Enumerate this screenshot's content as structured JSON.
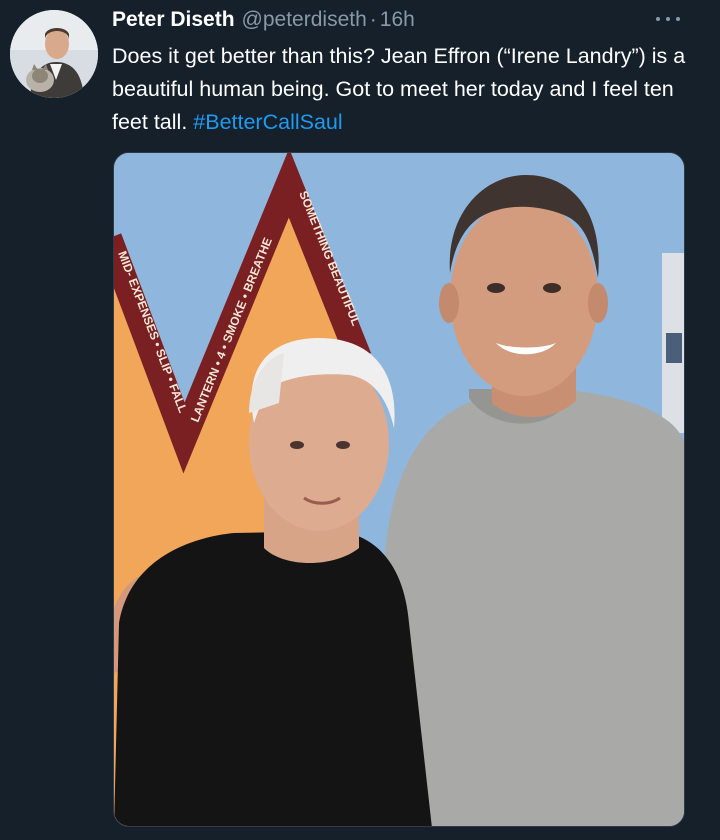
{
  "tweet": {
    "author_name": "Peter Diseth",
    "author_handle": "@peterdiseth",
    "separator": "·",
    "timestamp": "16h",
    "text": "Does it get better than this? Jean Effron (“Irene Landry”) is a beautiful human being. Got to meet her today and I feel ten feet tall. ",
    "hashtag": "#BetterCallSaul",
    "hashtag_color": "#1d9bf0",
    "more_icon": "more-horizontal-icon"
  },
  "media": {
    "banner_left": "MID- EXPENSES • SLIP • FALL",
    "banner_middle": "LANTERN • 4 • SMOKE • BREATHE",
    "banner_right": "SOMETHING BEAUTIFUL"
  },
  "colors": {
    "background": "#15202b",
    "secondary_text": "#8b98a5",
    "banner_red": "#7a1f22",
    "orange_panel": "#f2a65a",
    "sky_blue": "#8fb6dd"
  }
}
